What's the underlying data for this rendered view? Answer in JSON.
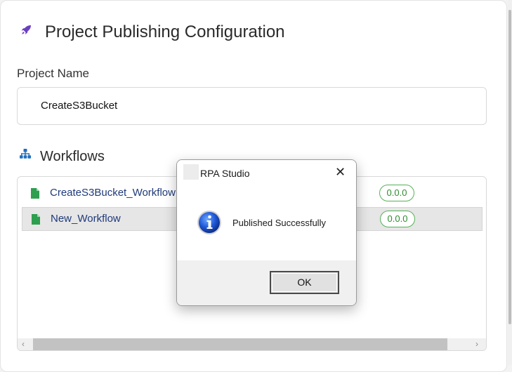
{
  "page": {
    "title": "Project Publishing Configuration",
    "project_name_label": "Project Name",
    "project_name_value": "CreateS3Bucket",
    "workflows_label": "Workflows"
  },
  "workflows": [
    {
      "name": "CreateS3Bucket_Workflow",
      "version": "0.0.0",
      "selected": false
    },
    {
      "name": "New_Workflow",
      "version": "0.0.0",
      "selected": true
    }
  ],
  "dialog": {
    "title": "RPA Studio",
    "message": "Published Successfully",
    "ok_label": "OK",
    "close_glyph": "✕",
    "icon": "info-icon"
  },
  "scrollbar": {
    "left_arrow": "‹",
    "right_arrow": "›"
  },
  "colors": {
    "accent_purple": "#6b3fc0",
    "link_blue": "#1f3a7a",
    "badge_green": "#2e8b2e",
    "file_green": "#2e9e4f"
  }
}
